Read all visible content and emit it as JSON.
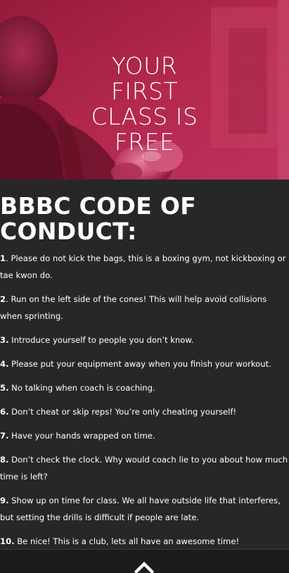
{
  "hero": {
    "title_lines": [
      "YOUR",
      "FIRST",
      "CLASS IS",
      "FREE"
    ],
    "overlay_color": "#b4244a"
  },
  "code_of_conduct": {
    "heading_lines": [
      "BBBC CODE OF",
      "CONDUCT:"
    ],
    "rules": [
      {
        "num": "1",
        "text": ". Please do not kick the bags, this is a boxing gym, not kickboxing or tae kwon do."
      },
      {
        "num": "2",
        "text": ". Run on the left side of the cones!  This will help avoid collisions when sprinting."
      },
      {
        "num": "3.",
        "text": " Introduce yourself to people you don’t know."
      },
      {
        "num": "4.",
        "text": " Please put your equipment away when you finish your workout."
      },
      {
        "num": "5.",
        "text": " No talking when coach is coaching."
      },
      {
        "num": "6.",
        "text": " Don’t cheat or skip reps!  You’re only cheating yourself!"
      },
      {
        "num": "7.",
        "text": " Have your hands wrapped on time."
      },
      {
        "num": "8.",
        "text": " Don’t check the clock.  Why would coach lie to you about how much time is left?"
      },
      {
        "num": "9.",
        "text": " Show up on time for class.  We all have outside life that interferes, but setting the drills is difficult if people are late."
      },
      {
        "num": "10.",
        "text": " Be nice!  This is a club, lets all have an awesome time!"
      }
    ]
  },
  "footer": {
    "scroll_top_icon": "chevron-up-icon",
    "background": "#1c1c1c"
  }
}
